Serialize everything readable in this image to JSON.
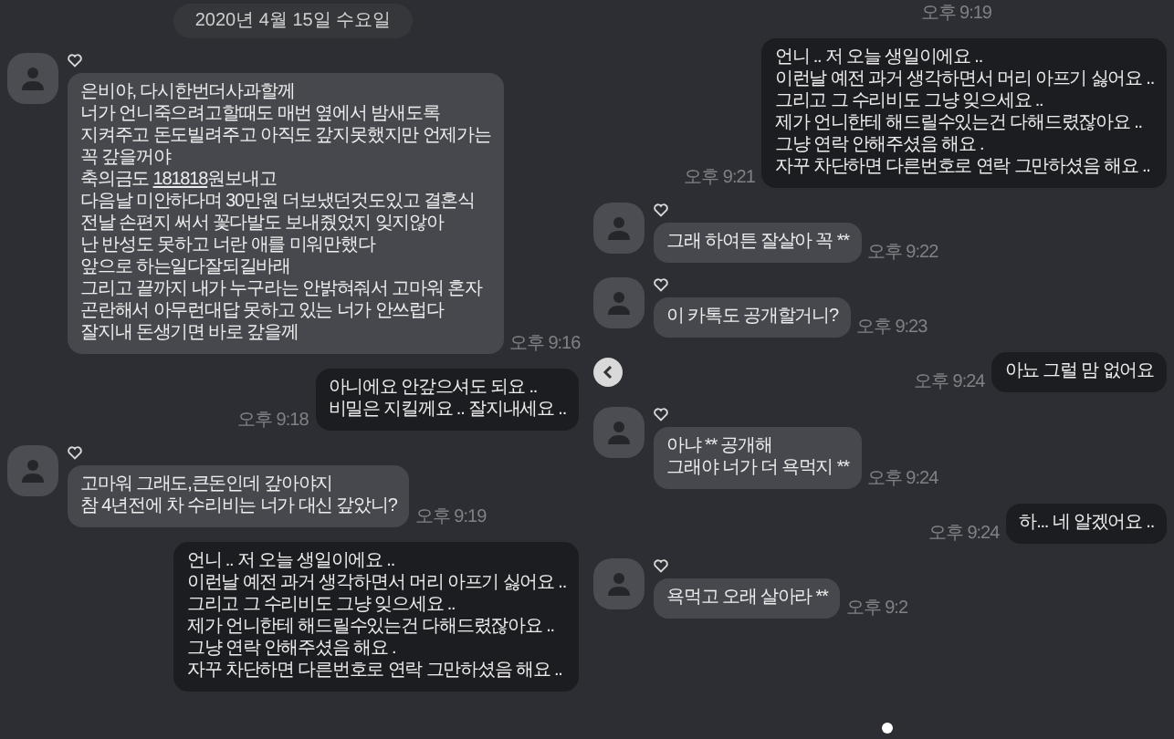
{
  "panels": [
    {
      "messages": [
        {
          "kind": "date",
          "text": "2020년 4월 15일 수요일"
        },
        {
          "kind": "received",
          "time": "오후 9:16",
          "lines": [
            "은비야, 다시한번더사과할께",
            "너가 언니죽으려고할때도 매번 옆에서 밤새도록",
            "지켜주고 돈도빌려주고 아직도 갚지못했지만 언제가는",
            "꼭 갚을꺼야",
            {
              "parts": [
                {
                  "text": "축의금도 ",
                  "link": false
                },
                {
                  "text": "181818",
                  "link": true
                },
                {
                  "text": "원보내고",
                  "link": false
                }
              ]
            },
            "다음날 미안하다며 30만원 더보냈던것도있고 결혼식",
            "전날 손편지 써서 꽃다발도 보내줬었지 잊지않아",
            "난 반성도 못하고 너란 애를 미워만했다",
            "앞으로 하는일다잘되길바래",
            "그리고 끝까지 내가 누구라는 안밝혀줘서 고마워 혼자",
            "곤란해서 아무런대답 못하고 있는 너가 안쓰럽다",
            "잘지내 돈생기면 바로 갚을께"
          ]
        },
        {
          "kind": "sent",
          "time": "오후 9:18",
          "lines": [
            "아니에요 안갚으셔도 되요 ..",
            "비밀은 지킬께요 .. 잘지내세요 .."
          ]
        },
        {
          "kind": "received",
          "time": "오후 9:19",
          "lines": [
            "고마워 그래도,큰돈인데 갚아야지",
            "참 4년전에 차 수리비는 너가 대신 갚았니?"
          ]
        },
        {
          "kind": "sent",
          "lines": [
            "언니 .. 저 오늘 생일이에요 ..",
            "이런날 예전 과거 생각하면서 머리 아프기 싫어요 ..",
            "그리고 그 수리비도 그냥 잊으세요 ..",
            "제가 언니한테 해드릴수있는건 다해드렸잖아요 ..",
            "그냥 연락 안해주셨음 해요 .",
            "자꾸 차단하면 다른번호로 연락 그만하셨음 해요 .."
          ]
        }
      ]
    },
    {
      "messages": [
        {
          "kind": "time",
          "text": "오후 9:19"
        },
        {
          "kind": "sent",
          "time": "오후 9:21",
          "lines": [
            "언니 .. 저 오늘 생일이에요 ..",
            "이런날 예전 과거 생각하면서 머리 아프기 싫어요 ..",
            "그리고 그 수리비도 그냥 잊으세요 ..",
            "제가 언니한테 해드릴수있는건 다해드렸잖아요 ..",
            "그냥 연락 안해주셨음 해요 .",
            "자꾸 차단하면 다른번호로 연락 그만하셨음 해요 .."
          ]
        },
        {
          "kind": "received",
          "time": "오후 9:22",
          "lines": [
            "그래 하여튼 잘살아 꼭 **"
          ]
        },
        {
          "kind": "received",
          "time": "오후 9:23",
          "lines": [
            "이 카톡도 공개할거니?"
          ]
        },
        {
          "kind": "sent",
          "time": "오후 9:24",
          "lines": [
            "아뇨 그럴 맘 없어요"
          ]
        },
        {
          "kind": "received",
          "time": "오후 9:24",
          "lines": [
            "아냐 ** 공개해",
            "그래야 너가 더 욕먹지 **"
          ]
        },
        {
          "kind": "sent",
          "time": "오후 9:24",
          "lines": [
            "하... 네 알겠어요 .."
          ]
        },
        {
          "kind": "received",
          "time": "오후 9:2",
          "lines": [
            "욕먹고 오래 살아라 **"
          ]
        }
      ]
    }
  ]
}
